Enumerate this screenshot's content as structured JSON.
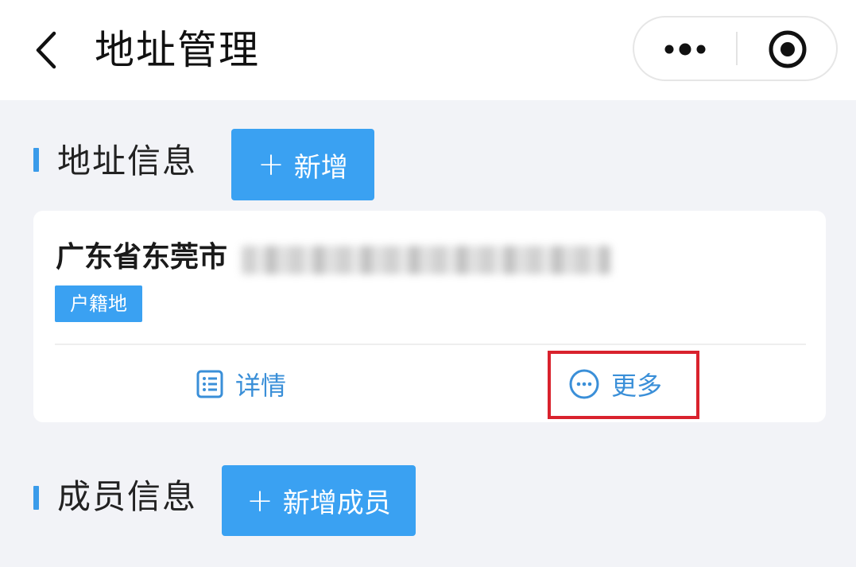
{
  "header": {
    "title": "地址管理",
    "back_icon": "chevron-left-icon",
    "more_icon": "more-dots-icon",
    "close_icon": "target-circle-icon"
  },
  "address_section": {
    "title": "地址信息",
    "add_button": {
      "plus": "+",
      "label": "新增"
    }
  },
  "address_card": {
    "address": "广东省东莞市",
    "tag": "户籍地",
    "actions": [
      {
        "label": "详情",
        "icon": "list-icon"
      },
      {
        "label": "更多",
        "icon": "more-circle-icon"
      }
    ]
  },
  "member_section": {
    "title": "成员信息",
    "add_button": {
      "plus": "+",
      "label": "新增成员"
    }
  },
  "colors": {
    "accent": "#3aa1f2",
    "link": "#3a8fd8",
    "highlight": "#d9222d",
    "background": "#f2f3f7"
  }
}
